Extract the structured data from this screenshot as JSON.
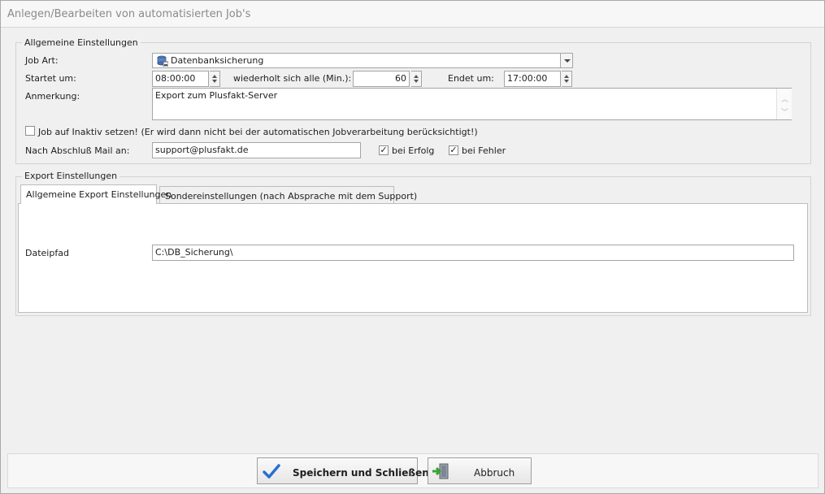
{
  "window": {
    "title": "Anlegen/Bearbeiten von automatisierten Job's"
  },
  "general": {
    "legend": "Allgemeine Einstellungen",
    "job_art_label": "Job Art:",
    "job_art_value": "Datenbanksicherung",
    "start_label": "Startet um:",
    "start_value": "08:00:00",
    "repeat_label": "wiederholt sich alle (Min.):",
    "repeat_value": "60",
    "end_label": "Endet um:",
    "end_value": "17:00:00",
    "note_label": "Anmerkung:",
    "note_value": "Export zum Plusfakt-Server",
    "inactive_label": "Job auf Inaktiv setzen! (Er wird dann nicht bei der automatischen Jobverarbeitung berücksichtigt!)",
    "inactive_checked": false,
    "mail_label": "Nach Abschluß Mail an:",
    "mail_value": "support@plusfakt.de",
    "success_label": "bei Erfolg",
    "success_checked": true,
    "error_label": "bei Fehler",
    "error_checked": true
  },
  "export": {
    "legend": "Export Einstellungen",
    "tabs": [
      {
        "label": "Allgemeine Export Einstellungen",
        "active": true
      },
      {
        "label": "Sondereinstellungen (nach Absprache mit dem Support)",
        "active": false
      }
    ],
    "path_label": "Dateipfad",
    "path_value": "C:\\DB_Sicherung\\"
  },
  "buttons": {
    "save_label": "Speichern und Schließen",
    "cancel_label": "Abbruch"
  },
  "icons": {
    "job_type": "database-backup-icon",
    "save": "checkmark-icon",
    "cancel": "exit-door-icon",
    "check_mark": "✓"
  },
  "colors": {
    "save_check": "#2a6fd1",
    "cancel_arrow": "#3aa335",
    "title_text": "#8a8a8a"
  }
}
